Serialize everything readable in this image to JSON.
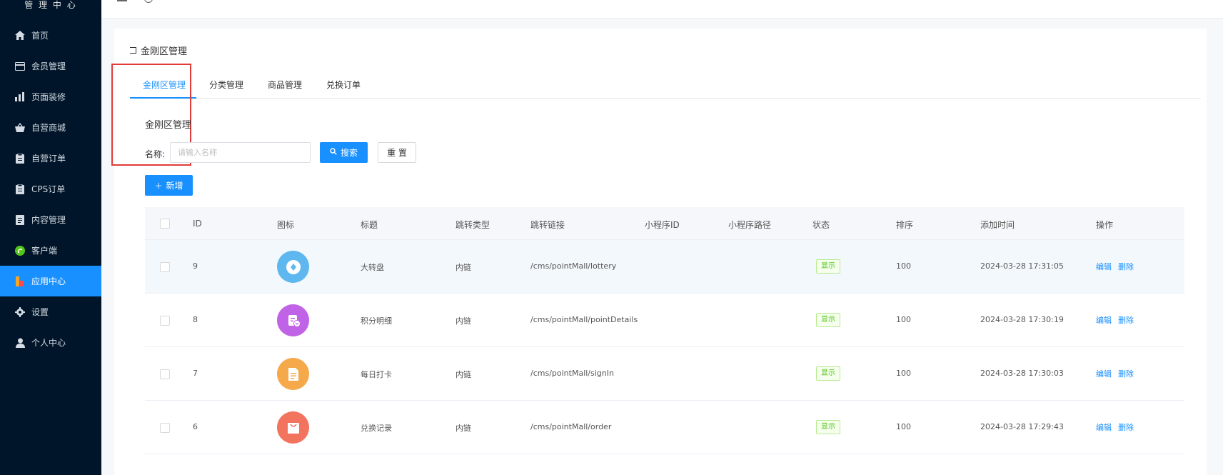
{
  "sidebar": {
    "brand": "管 理 中 心",
    "items": [
      {
        "label": "首页",
        "icon": "home-icon"
      },
      {
        "label": "会员管理",
        "icon": "card-icon"
      },
      {
        "label": "页面装修",
        "icon": "bar-chart-icon"
      },
      {
        "label": "自营商城",
        "icon": "shop-basket-icon"
      },
      {
        "label": "自营订单",
        "icon": "clipboard-icon"
      },
      {
        "label": "CPS订单",
        "icon": "clipboard-icon"
      },
      {
        "label": "内容管理",
        "icon": "document-icon"
      },
      {
        "label": "客户端",
        "icon": "client-icon"
      },
      {
        "label": "应用中心",
        "icon": "apps-icon",
        "active": true
      },
      {
        "label": "设置",
        "icon": "gear-icon"
      },
      {
        "label": "个人中心",
        "icon": "user-icon"
      }
    ]
  },
  "page": {
    "title": "金刚区管理",
    "tabs": [
      "金刚区管理",
      "分类管理",
      "商品管理",
      "兑换订单"
    ],
    "section_title": "金刚区管理"
  },
  "filter": {
    "name_label": "名称:",
    "name_placeholder": "请输入名称",
    "search_label": "搜索",
    "reset_label": "重 置",
    "add_label": "新增"
  },
  "table": {
    "columns": [
      "ID",
      "图标",
      "标题",
      "跳转类型",
      "跳转链接",
      "小程序ID",
      "小程序路径",
      "状态",
      "排序",
      "添加时间",
      "操作"
    ],
    "rows": [
      {
        "id": "9",
        "title": "大转盘",
        "jump_type": "内链",
        "link": "/cms/pointMall/lottery",
        "status": "显示",
        "sort": "100",
        "time": "2024-03-28 17:31:05",
        "icon": "lottery-icon",
        "icon_color": "#5fb7f0"
      },
      {
        "id": "8",
        "title": "积分明细",
        "jump_type": "内链",
        "link": "/cms/pointMall/pointDetails",
        "status": "显示",
        "sort": "100",
        "time": "2024-03-28 17:30:19",
        "icon": "points-detail-icon",
        "icon_color": "#c063e6"
      },
      {
        "id": "7",
        "title": "每日打卡",
        "jump_type": "内链",
        "link": "/cms/pointMall/signIn",
        "status": "显示",
        "sort": "100",
        "time": "2024-03-28 17:30:03",
        "icon": "sign-in-icon",
        "icon_color": "#f5a94a"
      },
      {
        "id": "6",
        "title": "兑换记录",
        "jump_type": "内链",
        "link": "/cms/pointMall/order",
        "status": "显示",
        "sort": "100",
        "time": "2024-03-28 17:29:43",
        "icon": "exchange-bag-icon",
        "icon_color": "#f2735e"
      }
    ],
    "edit_label": "编辑",
    "delete_label": "删除"
  },
  "colors": {
    "sidebar_bg": "#001529",
    "accent": "#1890ff",
    "status_green": "#52c41a",
    "highlight_red": "#e23b3b"
  }
}
